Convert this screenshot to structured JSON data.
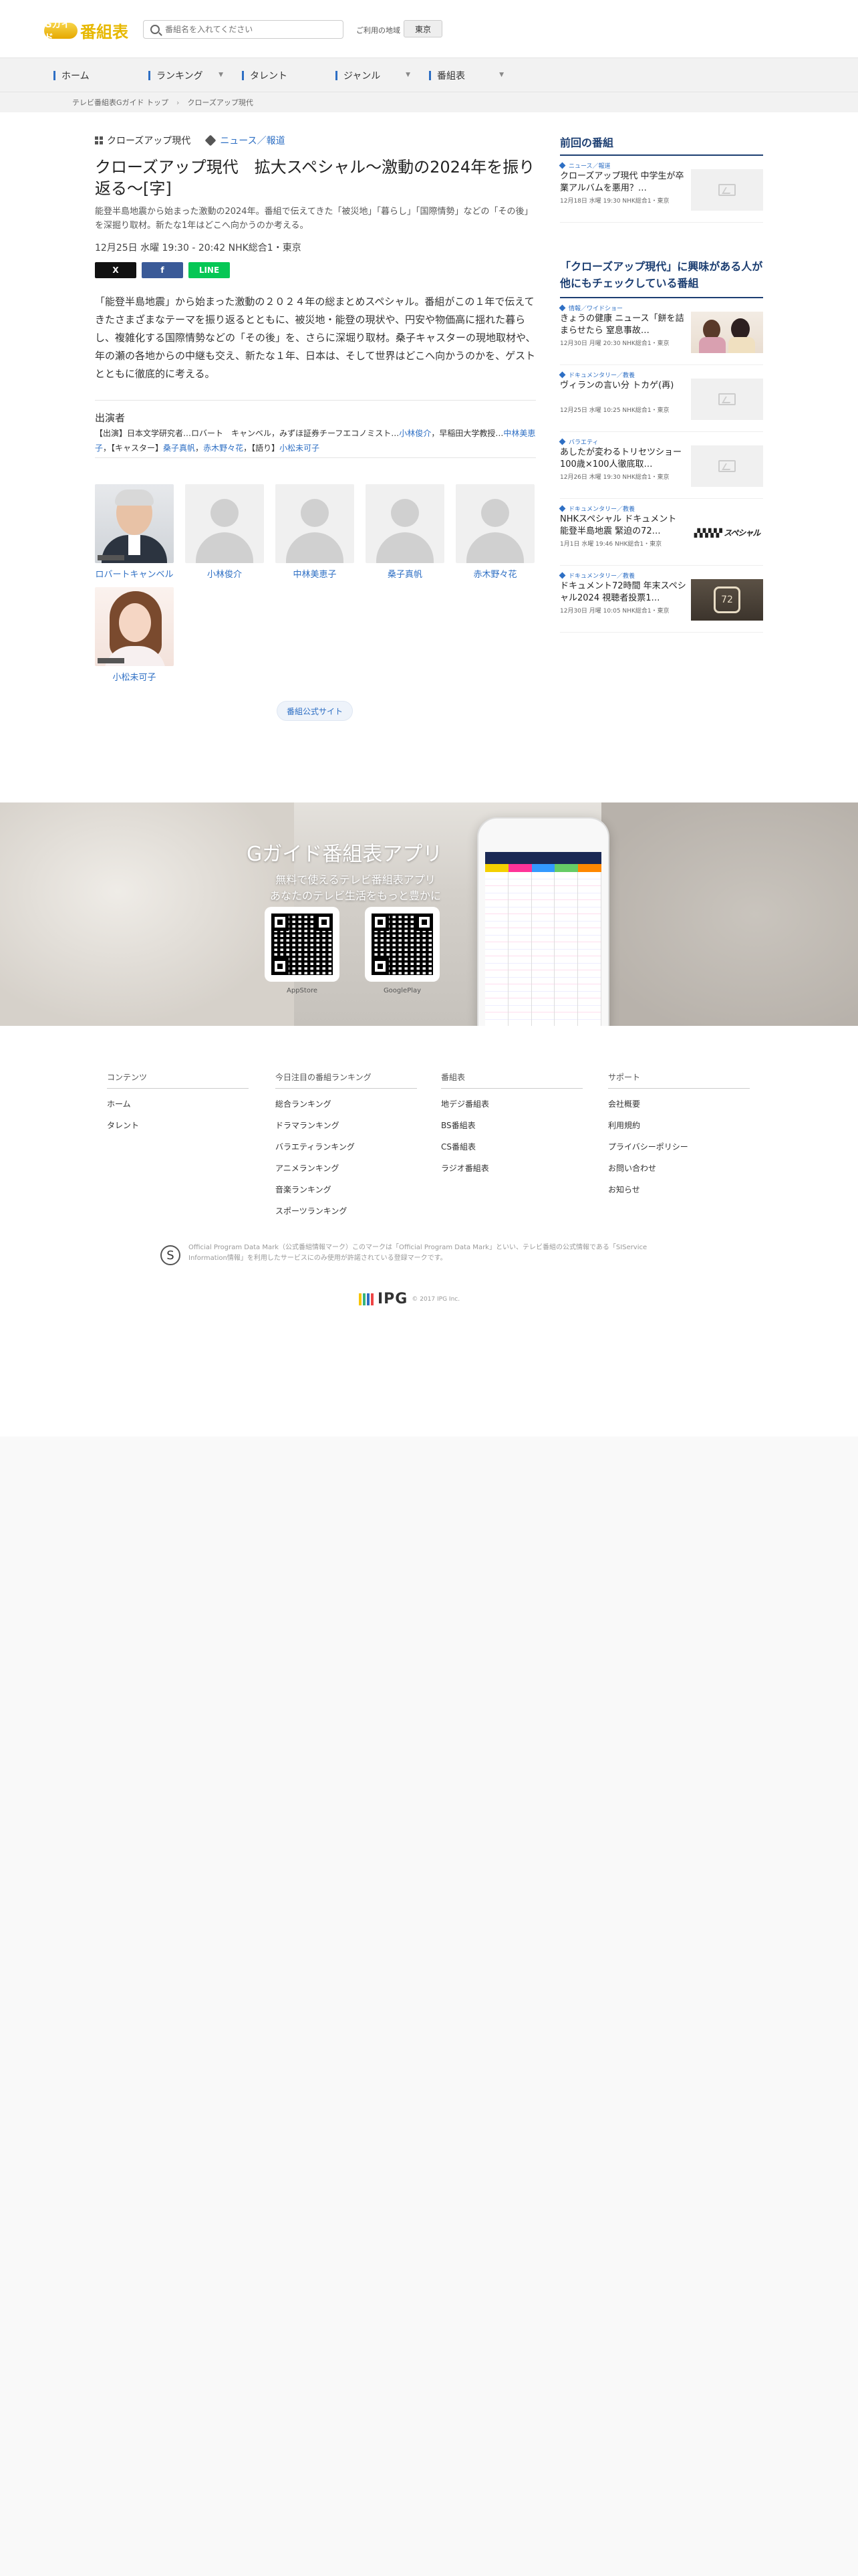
{
  "header": {
    "logo_badge": "Gガイド",
    "logo_text": "番組表",
    "search_placeholder": "番組名を入れてください",
    "region_label": "ご利用の地域",
    "region_button": "東京"
  },
  "nav": [
    {
      "label": "ホーム"
    },
    {
      "label": "ランキング"
    },
    {
      "label": "タレント"
    },
    {
      "label": "ジャンル"
    },
    {
      "label": "番組表"
    }
  ],
  "breadcrumb": [
    "テレビ番組表Gガイド トップ",
    "クローズアップ現代"
  ],
  "program": {
    "series": "クローズアップ現代",
    "genre": "ニュース／報道",
    "title": "クローズアップ現代　拡大スペシャル～激動の2024年を振り返る～[字]",
    "description": "能登半島地震から始まった激動の2024年。番組で伝えてきた「被災地」「暮らし」「国際情勢」などの「その後」を深掘り取材。新たな1年はどこへ向かうのか考える。",
    "airtime": "12月25日 水曜 19:30 - 20:42 NHK総合1・東京",
    "body": "「能登半島地震」から始まった激動の２０２４年の総まとめスペシャル。番組がこの１年で伝えてきたさまざまなテーマを振り返るとともに、被災地・能登の現状や、円安や物価高に揺れた暮らし、複雑化する国際情勢などの「その後」を、さらに深堀り取材。桑子キャスターの現地取材や、年の瀬の各地からの中継も交え、新たな１年、日本は、そして世界はどこへ向かうのかを、ゲストとともに徹底的に考える。"
  },
  "share": {
    "x": "X",
    "facebook": "f",
    "line": "LINE"
  },
  "cast": {
    "heading": "出演者",
    "parts": [
      {
        "t": "【出演】日本文学研究者…ロバート　キャンベル，みずほ証券チーフエコノミスト…",
        "link": false
      },
      {
        "t": "小林俊介",
        "link": true
      },
      {
        "t": "，早稲田大学教授…",
        "link": false
      },
      {
        "t": "中林美恵子",
        "link": true
      },
      {
        "t": "，【キャスター】",
        "link": false
      },
      {
        "t": "桑子真帆",
        "link": true
      },
      {
        "t": "，",
        "link": false
      },
      {
        "t": "赤木野々花",
        "link": true
      },
      {
        "t": "，【語り】",
        "link": false
      },
      {
        "t": "小松未可子",
        "link": true
      }
    ],
    "people": [
      {
        "name": "ロバートキャンベル",
        "photo": "man"
      },
      {
        "name": "小林俊介",
        "photo": "none"
      },
      {
        "name": "中林美恵子",
        "photo": "none"
      },
      {
        "name": "桑子真帆",
        "photo": "none"
      },
      {
        "name": "赤木野々花",
        "photo": "none"
      },
      {
        "name": "小松未可子",
        "photo": "woman"
      }
    ]
  },
  "official_button": "番組公式サイト",
  "sidebar": {
    "prev_heading": "前回の番組",
    "prev": {
      "genre": "ニュース／報道",
      "title": "クローズアップ現代 中学生が卒業アルバムを悪用？…",
      "meta": "12月18日 水曜 19:30 NHK総合1・東京"
    },
    "related_heading": "「クローズアップ現代」に興味がある人が他にもチェックしている番組",
    "related": [
      {
        "genre": "情報／ワイドショー",
        "title": "きょうの健康 ニュース「餅を詰まらせたら 窒息事故…",
        "meta": "12月30日 月曜 20:30 NHK総合1・東京",
        "thumb": "photo"
      },
      {
        "genre": "ドキュメンタリー／教養",
        "title": "ヴィランの言い分 トカゲ(再)",
        "meta": "12月25日 水曜 10:25 NHK総合1・東京",
        "thumb": "none"
      },
      {
        "genre": "バラエティ",
        "title": "あしたが変わるトリセツショー100歳×100人徹底取…",
        "meta": "12月26日 木曜 19:30 NHK総合1・東京",
        "thumb": "none"
      },
      {
        "genre": "ドキュメンタリー／教養",
        "title": "NHKスペシャル ドキュメント 能登半島地震 緊迫の72…",
        "meta": "1月1日 水曜 19:46 NHK総合1・東京",
        "thumb": "nhksp"
      },
      {
        "genre": "ドキュメンタリー／教養",
        "title": "ドキュメント72時間 年末スペシャル2024 視聴者投票1…",
        "meta": "12月30日 月曜 10:05 NHK総合1・東京",
        "thumb": "72h"
      }
    ]
  },
  "app": {
    "title": "Gガイド番組表アプリ",
    "sub1": "無料で使えるテレビ番組表アプリ",
    "sub2": "あなたのテレビ生活をもっと豊かに",
    "qr1": "AppStore",
    "qr2": "GooglePlay"
  },
  "footer": {
    "cols": [
      {
        "heading": "コンテンツ",
        "links": [
          "ホーム",
          "タレント"
        ]
      },
      {
        "heading": "今日注目の番組ランキング",
        "links": [
          "総合ランキング",
          "ドラマランキング",
          "バラエティランキング",
          "アニメランキング",
          "音楽ランキング",
          "スポーツランキング"
        ]
      },
      {
        "heading": "番組表",
        "links": [
          "地デジ番組表",
          "BS番組表",
          "CS番組表",
          "ラジオ番組表"
        ]
      },
      {
        "heading": "サポート",
        "links": [
          "会社概要",
          "利用規約",
          "プライバシーポリシー",
          "お問い合わせ",
          "お知らせ"
        ]
      }
    ],
    "copy_mark": "S",
    "copy_text": "Official Program Data Mark（公式番組情報マーク）このマークは「Official Program Data Mark」といい、テレビ番組の公式情報である「SIService Information情報」を利用したサービスにのみ使用が許諾されている登録マークです。",
    "ipg": "IPG",
    "ipg_copy": "© 2017 IPG Inc."
  },
  "colors": {
    "accent": "#2e6fc4",
    "navy": "#1d3f72",
    "logo": "#e7b800"
  }
}
